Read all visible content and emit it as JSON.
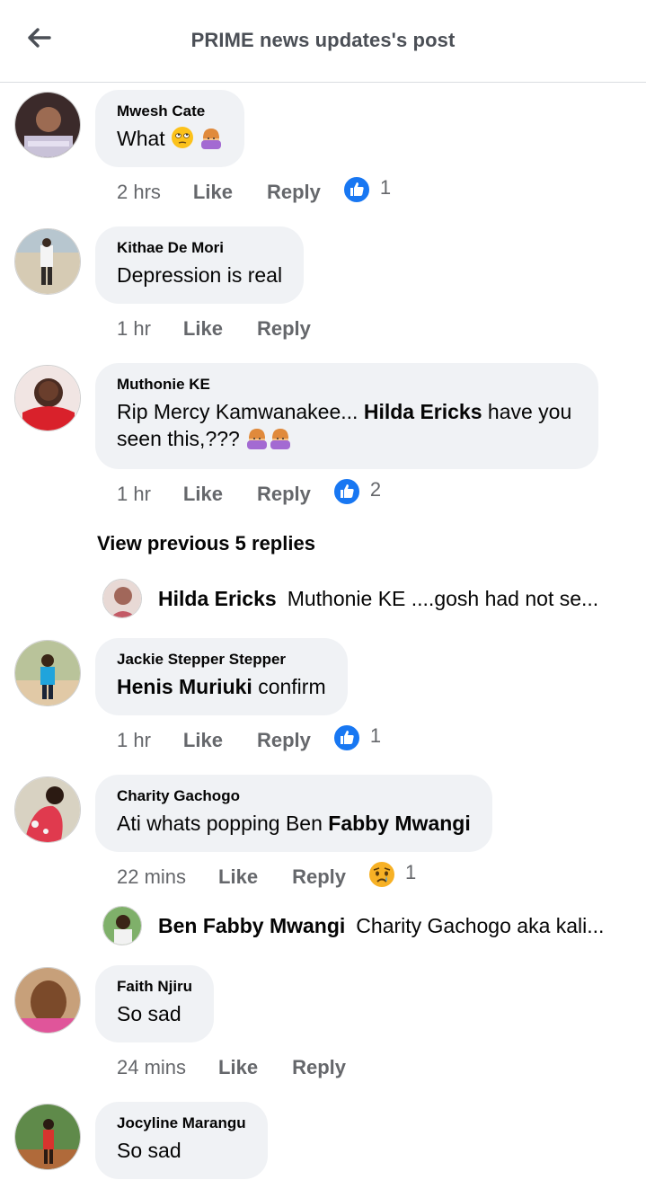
{
  "header": {
    "title": "PRIME news updates's post"
  },
  "actions": {
    "like": "Like",
    "reply": "Reply"
  },
  "comments": [
    {
      "author": "Mwesh Cate",
      "text": "What",
      "time": "2 hrs",
      "reaction_count": "1",
      "reaction": "like"
    },
    {
      "author": "Kithae De Mori",
      "text": "Depression is real",
      "time": "1 hr"
    },
    {
      "author": "Muthonie KE",
      "text_pre": "Rip Mercy Kamwanakee... ",
      "mention": "Hilda Ericks",
      "text_post": " have you seen this,???",
      "time": "1 hr",
      "reaction_count": "2",
      "reaction": "like"
    },
    {
      "author": "Jackie Stepper Stepper",
      "mention": "Henis Muriuki",
      "text_post": " confirm",
      "time": "1 hr",
      "reaction_count": "1",
      "reaction": "like"
    },
    {
      "author": "Charity Gachogo",
      "text_pre": "Ati whats popping Ben ",
      "mention": "Fabby Mwangi",
      "time": "22 mins",
      "reaction_count": "1",
      "reaction": "sad"
    },
    {
      "author": "Faith Njiru",
      "text": "So sad",
      "time": "24 mins"
    },
    {
      "author": "Jocyline Marangu",
      "text": "So sad"
    }
  ],
  "view_previous": "View previous 5 replies",
  "reply_previews": [
    {
      "name": "Hilda Ericks",
      "text": "Muthonie KE ....gosh had not se..."
    },
    {
      "name": "Ben Fabby Mwangi",
      "text": "Charity Gachogo aka kali..."
    }
  ],
  "colors": {
    "like_blue": "#1877f2",
    "bubble": "#f0f2f5",
    "meta_gray": "#65676b"
  }
}
